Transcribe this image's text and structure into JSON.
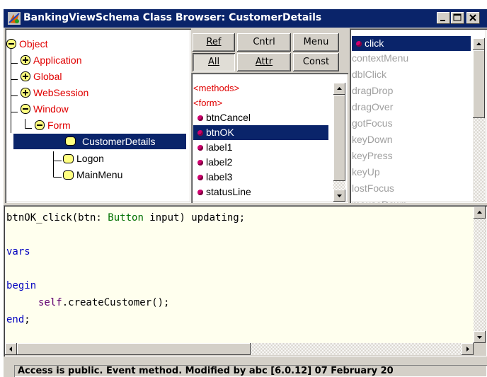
{
  "window": {
    "title": "BankingViewSchema Class Browser: CustomerDetails"
  },
  "tree": [
    {
      "label": "Object",
      "expander": "minus",
      "color": "red"
    },
    {
      "label": "Application",
      "expander": "plus",
      "color": "red"
    },
    {
      "label": "Global",
      "expander": "plus",
      "color": "red"
    },
    {
      "label": "WebSession",
      "expander": "plus",
      "color": "red"
    },
    {
      "label": "Window",
      "expander": "minus",
      "color": "red"
    },
    {
      "label": "Form",
      "expander": "minus",
      "color": "red"
    },
    {
      "label": "CustomerDetails",
      "selected": true
    },
    {
      "label": "Logon"
    },
    {
      "label": "MainMenu"
    }
  ],
  "buttons": {
    "ref": "Ref",
    "cntrl": "Cntrl",
    "menu": "Menu",
    "all": "All",
    "attr": "Attr",
    "const": "Const"
  },
  "members": [
    {
      "label": "<methods>",
      "color": "red"
    },
    {
      "label": "<form>",
      "color": "red"
    },
    {
      "label": "btnCancel"
    },
    {
      "label": "btnOK",
      "selected": true
    },
    {
      "label": "label1"
    },
    {
      "label": "label2"
    },
    {
      "label": "label3"
    },
    {
      "label": "statusLine"
    }
  ],
  "events": [
    {
      "label": "click",
      "selected": true
    },
    {
      "label": "contextMenu"
    },
    {
      "label": "dblClick"
    },
    {
      "label": "dragDrop"
    },
    {
      "label": "dragOver"
    },
    {
      "label": "gotFocus"
    },
    {
      "label": "keyDown"
    },
    {
      "label": "keyPress"
    },
    {
      "label": "keyUp"
    },
    {
      "label": "lostFocus"
    },
    {
      "label": "mouseDown"
    }
  ],
  "code": {
    "sig_name": "btnOK_click(btn: ",
    "sig_type": "Button",
    "sig_rest": " input) updating;",
    "vars": "vars",
    "begin": "begin",
    "call_self": "self",
    "call_rest": ".createCustomer();",
    "end_kw": "end",
    "end_semi": ";"
  },
  "status": "Access is public. Event method. Modified by abc [6.0.12] 07 February 20",
  "colors": {
    "titlebar": "#0a246a",
    "selection": "#0a246a",
    "editor_bg": "#ffffee",
    "keyword": "#0000c0",
    "class_ref": "#007000"
  }
}
